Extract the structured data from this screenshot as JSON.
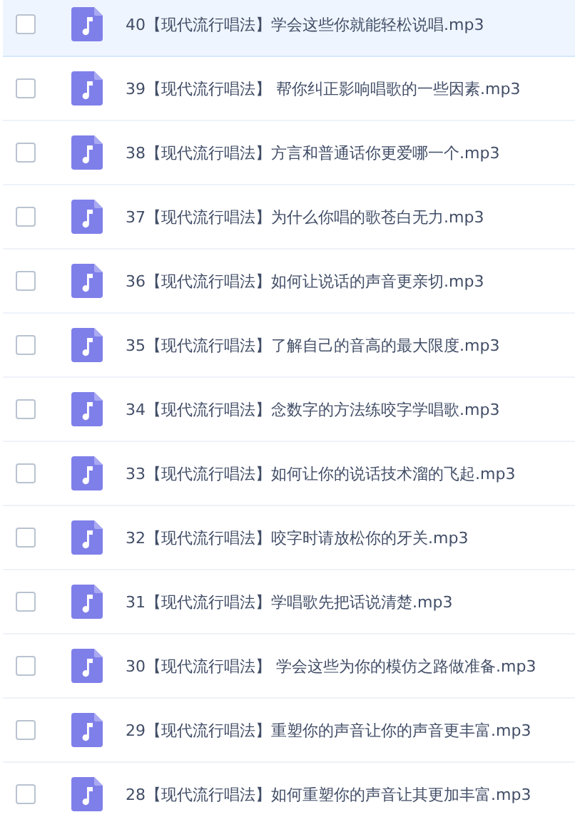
{
  "files": [
    {
      "name": "40【现代流行唱法】学会这些你就能轻松说唱.mp3",
      "checked": false,
      "highlighted": true
    },
    {
      "name": "39【现代流行唱法】 帮你纠正影响唱歌的一些因素.mp3",
      "checked": false,
      "highlighted": false
    },
    {
      "name": "38【现代流行唱法】方言和普通话你更爱哪一个.mp3",
      "checked": false,
      "highlighted": false
    },
    {
      "name": "37【现代流行唱法】为什么你唱的歌苍白无力.mp3",
      "checked": false,
      "highlighted": false
    },
    {
      "name": "36【现代流行唱法】如何让说话的声音更亲切.mp3",
      "checked": false,
      "highlighted": false
    },
    {
      "name": "35【现代流行唱法】了解自己的音高的最大限度.mp3",
      "checked": false,
      "highlighted": false
    },
    {
      "name": "34【现代流行唱法】念数字的方法练咬字学唱歌.mp3",
      "checked": false,
      "highlighted": false
    },
    {
      "name": "33【现代流行唱法】如何让你的说话技术溜的飞起.mp3",
      "checked": false,
      "highlighted": false
    },
    {
      "name": "32【现代流行唱法】咬字时请放松你的牙关.mp3",
      "checked": false,
      "highlighted": false
    },
    {
      "name": "31【现代流行唱法】学唱歌先把话说清楚.mp3",
      "checked": false,
      "highlighted": false
    },
    {
      "name": "30【现代流行唱法】 学会这些为你的模仿之路做准备.mp3",
      "checked": false,
      "highlighted": false
    },
    {
      "name": "29【现代流行唱法】重塑你的声音让你的声音更丰富.mp3",
      "checked": false,
      "highlighted": false
    },
    {
      "name": "28【现代流行唱法】如何重塑你的声音让其更加丰富.mp3",
      "checked": false,
      "highlighted": false
    }
  ]
}
